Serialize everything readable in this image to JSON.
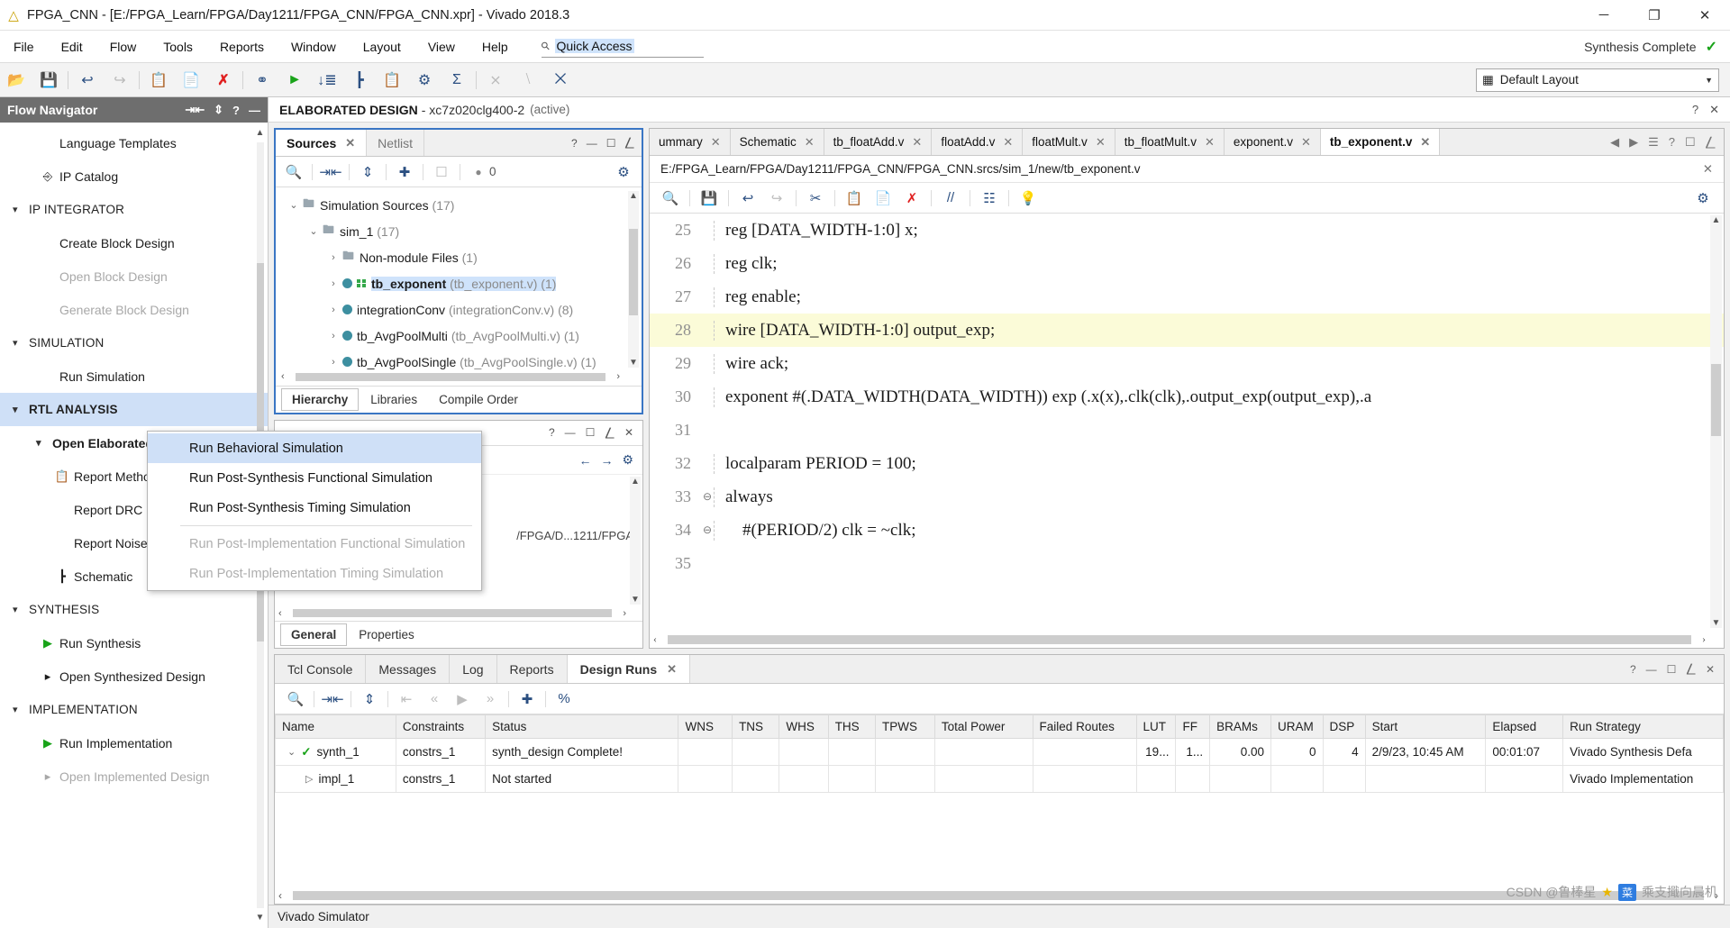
{
  "titlebar": {
    "title": "FPGA_CNN - [E:/FPGA_Learn/FPGA/Day1211/FPGA_CNN/FPGA_CNN.xpr] - Vivado 2018.3",
    "minimize": "─",
    "maximize": "❐",
    "close": "✕"
  },
  "menubar": {
    "items": [
      "File",
      "Edit",
      "Flow",
      "Tools",
      "Reports",
      "Window",
      "Layout",
      "View",
      "Help"
    ],
    "quick_access_placeholder": "Quick Access",
    "status_right": "Synthesis Complete",
    "status_check": "✓"
  },
  "toolbar": {
    "layout_label": "Default Layout",
    "icons": [
      "open-project",
      "save",
      "undo",
      "redo",
      "copy",
      "paste",
      "delete",
      "search-find",
      "run",
      "report-timing",
      "schematic",
      "report-methodology",
      "settings",
      "sum-sigma",
      "cross-probe-1",
      "cross-probe-2",
      "cross-probe-3"
    ]
  },
  "flow_navigator": {
    "header": "Flow Navigator",
    "items": [
      {
        "label": "Language Templates",
        "indent": "sub",
        "icon": "",
        "state": "normal"
      },
      {
        "label": "IP Catalog",
        "indent": "sub",
        "icon": "ip-catalog-icon",
        "state": "normal"
      },
      {
        "label": "IP INTEGRATOR",
        "indent": "group",
        "icon": "chevron-down-icon",
        "state": "normal"
      },
      {
        "label": "Create Block Design",
        "indent": "sub",
        "icon": "",
        "state": "normal"
      },
      {
        "label": "Open Block Design",
        "indent": "sub",
        "icon": "",
        "state": "disabled"
      },
      {
        "label": "Generate Block Design",
        "indent": "sub",
        "icon": "",
        "state": "disabled"
      },
      {
        "label": "SIMULATION",
        "indent": "group",
        "icon": "chevron-down-icon",
        "state": "normal"
      },
      {
        "label": "Run Simulation",
        "indent": "sub",
        "icon": "",
        "state": "normal"
      },
      {
        "label": "RTL ANALYSIS",
        "indent": "group",
        "icon": "chevron-down-icon",
        "state": "selected"
      },
      {
        "label": "Open Elaborated Design",
        "indent": "sub",
        "icon": "chevron-down-icon",
        "state": "bold"
      },
      {
        "label": "Report Methodology",
        "indent": "sub2",
        "icon": "clipboard-check-icon",
        "state": "normal"
      },
      {
        "label": "Report DRC",
        "indent": "sub2",
        "icon": "",
        "state": "normal"
      },
      {
        "label": "Report Noise",
        "indent": "sub2",
        "icon": "",
        "state": "normal"
      },
      {
        "label": "Schematic",
        "indent": "sub2",
        "icon": "schematic-icon",
        "state": "normal"
      },
      {
        "label": "SYNTHESIS",
        "indent": "group",
        "icon": "chevron-down-icon",
        "state": "normal"
      },
      {
        "label": "Run Synthesis",
        "indent": "sub",
        "icon": "play-icon",
        "state": "normal"
      },
      {
        "label": "Open Synthesized Design",
        "indent": "sub",
        "icon": "chevron-right-icon",
        "state": "normal"
      },
      {
        "label": "IMPLEMENTATION",
        "indent": "group",
        "icon": "chevron-down-icon",
        "state": "normal"
      },
      {
        "label": "Run Implementation",
        "indent": "sub",
        "icon": "play-icon",
        "state": "normal"
      },
      {
        "label": "Open Implemented Design",
        "indent": "sub",
        "icon": "chevron-right-icon",
        "state": "disabled"
      }
    ]
  },
  "design_header": {
    "title": "ELABORATED DESIGN",
    "subtitle": "- xc7z020clg400-2",
    "active": "(active)"
  },
  "sources_panel": {
    "tabs": [
      {
        "label": "Sources",
        "active": true,
        "closable": true
      },
      {
        "label": "Netlist",
        "active": false,
        "closable": false
      }
    ],
    "toolbar_badge": "0",
    "tree": [
      {
        "label": "Simulation Sources",
        "detail": "(17)",
        "level": 0,
        "type": "folder",
        "expander": "⌄",
        "selected": false
      },
      {
        "label": "sim_1",
        "detail": "(17)",
        "level": 1,
        "type": "folder",
        "expander": "⌄",
        "selected": false
      },
      {
        "label": "Non-module Files",
        "detail": "(1)",
        "level": 2,
        "type": "folder",
        "expander": "›",
        "selected": false
      },
      {
        "label": "tb_exponent",
        "detail": "(tb_exponent.v) (1)",
        "level": 2,
        "type": "module-top",
        "expander": "›",
        "selected": true
      },
      {
        "label": "integrationConv",
        "detail": "(integrationConv.v) (8)",
        "level": 2,
        "type": "module",
        "expander": "›",
        "selected": false
      },
      {
        "label": "tb_AvgPoolMulti",
        "detail": "(tb_AvgPoolMulti.v) (1)",
        "level": 2,
        "type": "module",
        "expander": "›",
        "selected": false
      },
      {
        "label": "tb_AvgPoolSingle",
        "detail": "(tb_AvgPoolSingle.v) (1)",
        "level": 2,
        "type": "module",
        "expander": "›",
        "selected": false
      }
    ],
    "bottom_tabs": [
      {
        "label": "Hierarchy",
        "active": true
      },
      {
        "label": "Libraries",
        "active": false
      },
      {
        "label": "Compile Order",
        "active": false
      }
    ]
  },
  "properties_panel": {
    "bottom_tabs": [
      {
        "label": "General",
        "active": true
      },
      {
        "label": "Properties",
        "active": false
      }
    ],
    "path_fragment": "/FPGA/D...1211/FPGA"
  },
  "editor": {
    "tabs": [
      {
        "label": "ummary",
        "active": false
      },
      {
        "label": "Schematic",
        "active": false
      },
      {
        "label": "tb_floatAdd.v",
        "active": false
      },
      {
        "label": "floatAdd.v",
        "active": false
      },
      {
        "label": "floatMult.v",
        "active": false
      },
      {
        "label": "tb_floatMult.v",
        "active": false
      },
      {
        "label": "exponent.v",
        "active": false
      },
      {
        "label": "tb_exponent.v",
        "active": true
      }
    ],
    "file_path": "E:/FPGA_Learn/FPGA/Day1211/FPGA_CNN/FPGA_CNN.srcs/sim_1/new/tb_exponent.v",
    "lines": [
      {
        "n": "25",
        "text": "reg [DATA_WIDTH-1:0] x;",
        "highlight": false,
        "fold": ""
      },
      {
        "n": "26",
        "text": "reg clk;",
        "highlight": false,
        "fold": ""
      },
      {
        "n": "27",
        "text": "reg enable;",
        "highlight": false,
        "fold": ""
      },
      {
        "n": "28",
        "text": "wire [DATA_WIDTH-1:0] output_exp;",
        "highlight": true,
        "fold": ""
      },
      {
        "n": "29",
        "text": "wire ack;",
        "highlight": false,
        "fold": ""
      },
      {
        "n": "30",
        "text": "exponent #(.DATA_WIDTH(DATA_WIDTH)) exp (.x(x),.clk(clk),.output_exp(output_exp),.a",
        "highlight": false,
        "fold": ""
      },
      {
        "n": "31",
        "text": "",
        "highlight": false,
        "fold": ""
      },
      {
        "n": "32",
        "text": "localparam PERIOD = 100;",
        "highlight": false,
        "fold": ""
      },
      {
        "n": "33",
        "text": "always",
        "highlight": false,
        "fold": "⊖"
      },
      {
        "n": "34",
        "text": "    #(PERIOD/2) clk = ~clk;",
        "highlight": false,
        "fold": "⊖"
      },
      {
        "n": "35",
        "text": "",
        "highlight": false,
        "fold": ""
      }
    ]
  },
  "context_menu": {
    "items": [
      {
        "label": "Run Behavioral Simulation",
        "state": "highlighted"
      },
      {
        "label": "Run Post-Synthesis Functional Simulation",
        "state": "normal"
      },
      {
        "label": "Run Post-Synthesis Timing Simulation",
        "state": "normal"
      },
      {
        "label": "Run Post-Implementation Functional Simulation",
        "state": "disabled"
      },
      {
        "label": "Run Post-Implementation Timing Simulation",
        "state": "disabled"
      }
    ]
  },
  "bottom_panel": {
    "tabs": [
      {
        "label": "Tcl Console",
        "active": false,
        "closable": false
      },
      {
        "label": "Messages",
        "active": false,
        "closable": false
      },
      {
        "label": "Log",
        "active": false,
        "closable": false
      },
      {
        "label": "Reports",
        "active": false,
        "closable": false
      },
      {
        "label": "Design Runs",
        "active": true,
        "closable": true
      }
    ],
    "columns": [
      "Name",
      "Constraints",
      "Status",
      "WNS",
      "TNS",
      "WHS",
      "THS",
      "TPWS",
      "Total Power",
      "Failed Routes",
      "LUT",
      "FF",
      "BRAMs",
      "URAM",
      "DSP",
      "Start",
      "Elapsed",
      "Run Strategy"
    ],
    "rows": [
      {
        "name": "synth_1",
        "expander": "⌄",
        "status_icon": "✓",
        "indent": 0,
        "constraints": "constrs_1",
        "status": "synth_design Complete!",
        "wns": "",
        "tns": "",
        "whs": "",
        "ths": "",
        "tpws": "",
        "total_power": "",
        "failed_routes": "",
        "lut": "19...",
        "ff": "1...",
        "brams": "0.00",
        "uram": "0",
        "dsp": "4",
        "start": "2/9/23, 10:45 AM",
        "elapsed": "00:01:07",
        "strategy": "Vivado Synthesis Defa"
      },
      {
        "name": "impl_1",
        "expander": "▷",
        "status_icon": "",
        "indent": 1,
        "constraints": "constrs_1",
        "status": "Not started",
        "wns": "",
        "tns": "",
        "whs": "",
        "ths": "",
        "tpws": "",
        "total_power": "",
        "failed_routes": "",
        "lut": "",
        "ff": "",
        "brams": "",
        "uram": "",
        "dsp": "",
        "start": "",
        "elapsed": "",
        "strategy": "Vivado Implementation"
      }
    ]
  },
  "statusbar": {
    "text": "Vivado Simulator"
  },
  "watermark": {
    "text": "CSDN @鲁棒星",
    "badge": "菜",
    "tail": "乘支擑向晨机"
  }
}
